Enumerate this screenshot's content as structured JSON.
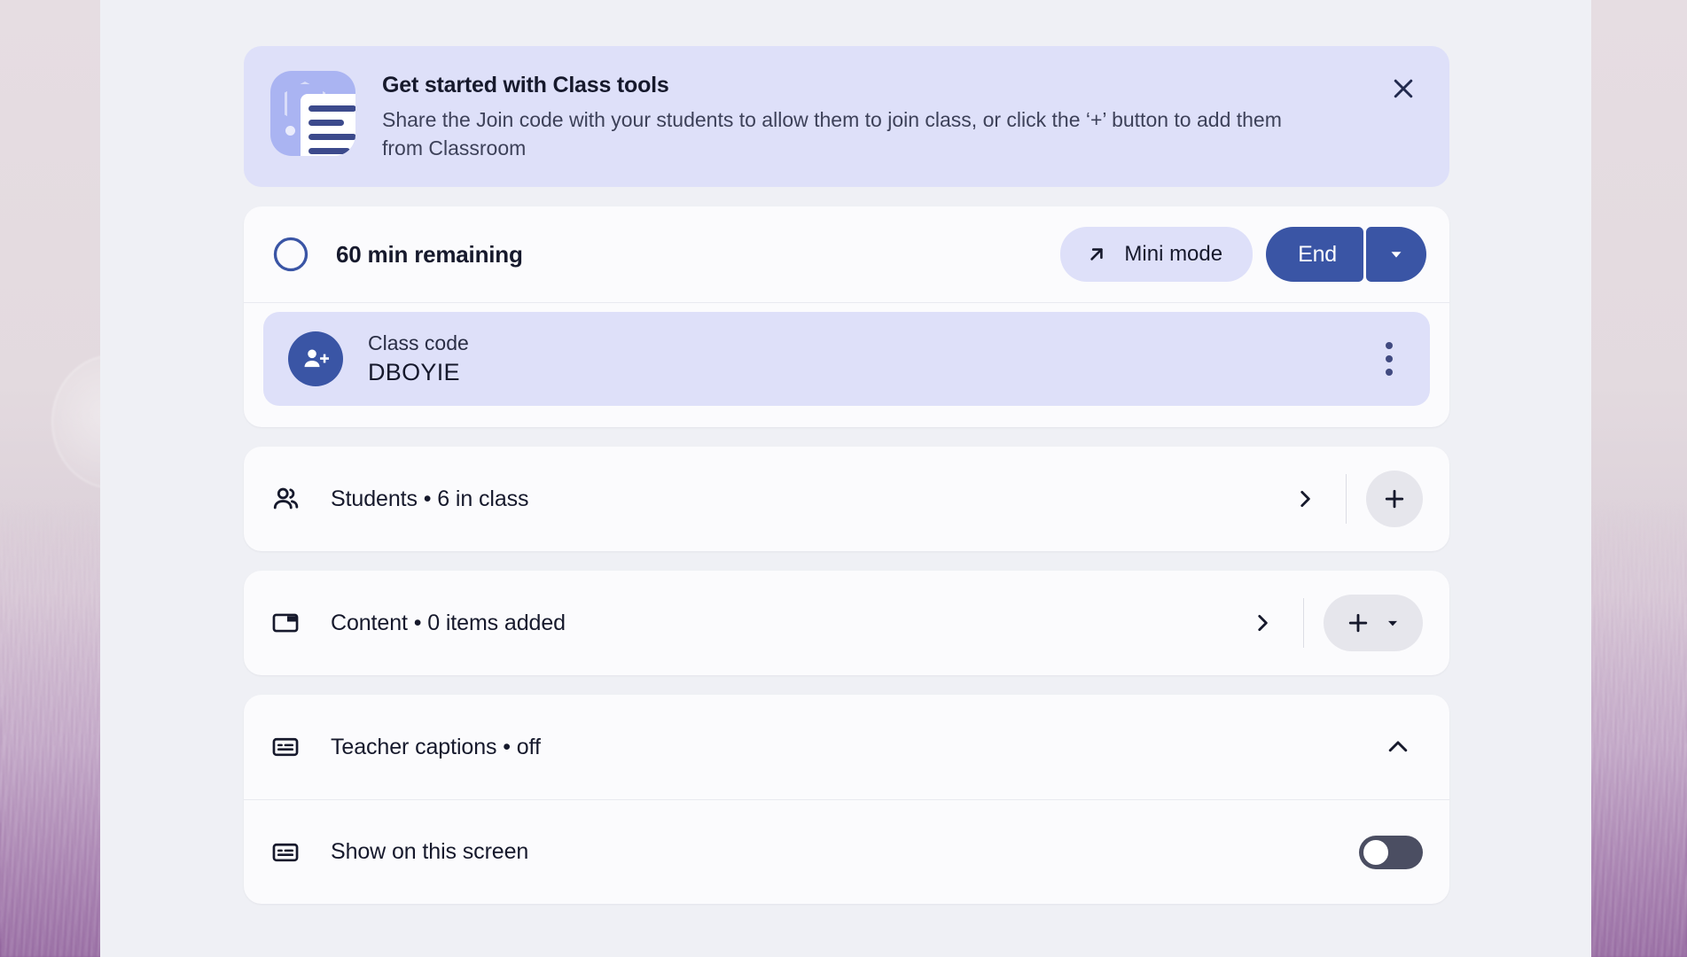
{
  "banner": {
    "icon": "class-tools-document-icon",
    "title": "Get started with Class tools",
    "body": "Share the Join code with your students to allow them to join class, or click the ‘+’ button to add them from Classroom",
    "close_icon": "close-icon"
  },
  "timer": {
    "icon": "timer-pie-icon",
    "label": "60 min remaining",
    "mini_mode_label": "Mini mode",
    "mini_mode_icon": "arrow-up-right-icon",
    "end_label": "End",
    "end_dropdown_icon": "chevron-down-icon"
  },
  "class_code": {
    "icon": "person-add-icon",
    "caption": "Class code",
    "value": "DBOYIE",
    "menu_icon": "more-vert-icon"
  },
  "students": {
    "icon": "people-icon",
    "label": "Students • 6 in class",
    "expand_icon": "chevron-right-icon",
    "add_icon": "plus-icon"
  },
  "content": {
    "icon": "window-content-icon",
    "label": "Content • 0 items added",
    "expand_icon": "chevron-right-icon",
    "add_icon": "plus-icon",
    "add_caret_icon": "caret-down-icon"
  },
  "captions": {
    "icon": "closed-caption-icon",
    "label": "Teacher captions • off",
    "collapse_icon": "chevron-up-icon",
    "screen_row": {
      "icon": "closed-caption-icon",
      "label": "Show on this screen",
      "toggle_state": "off"
    }
  },
  "colors": {
    "accent_blue": "#3a55a5",
    "banner_bg": "#dee0f9",
    "panel_bg": "#eff0f5",
    "card_bg": "#fbfbfd",
    "text_primary": "#16192c",
    "control_gray": "#e6e6ec",
    "toggle_track_off": "#4b4e62"
  }
}
